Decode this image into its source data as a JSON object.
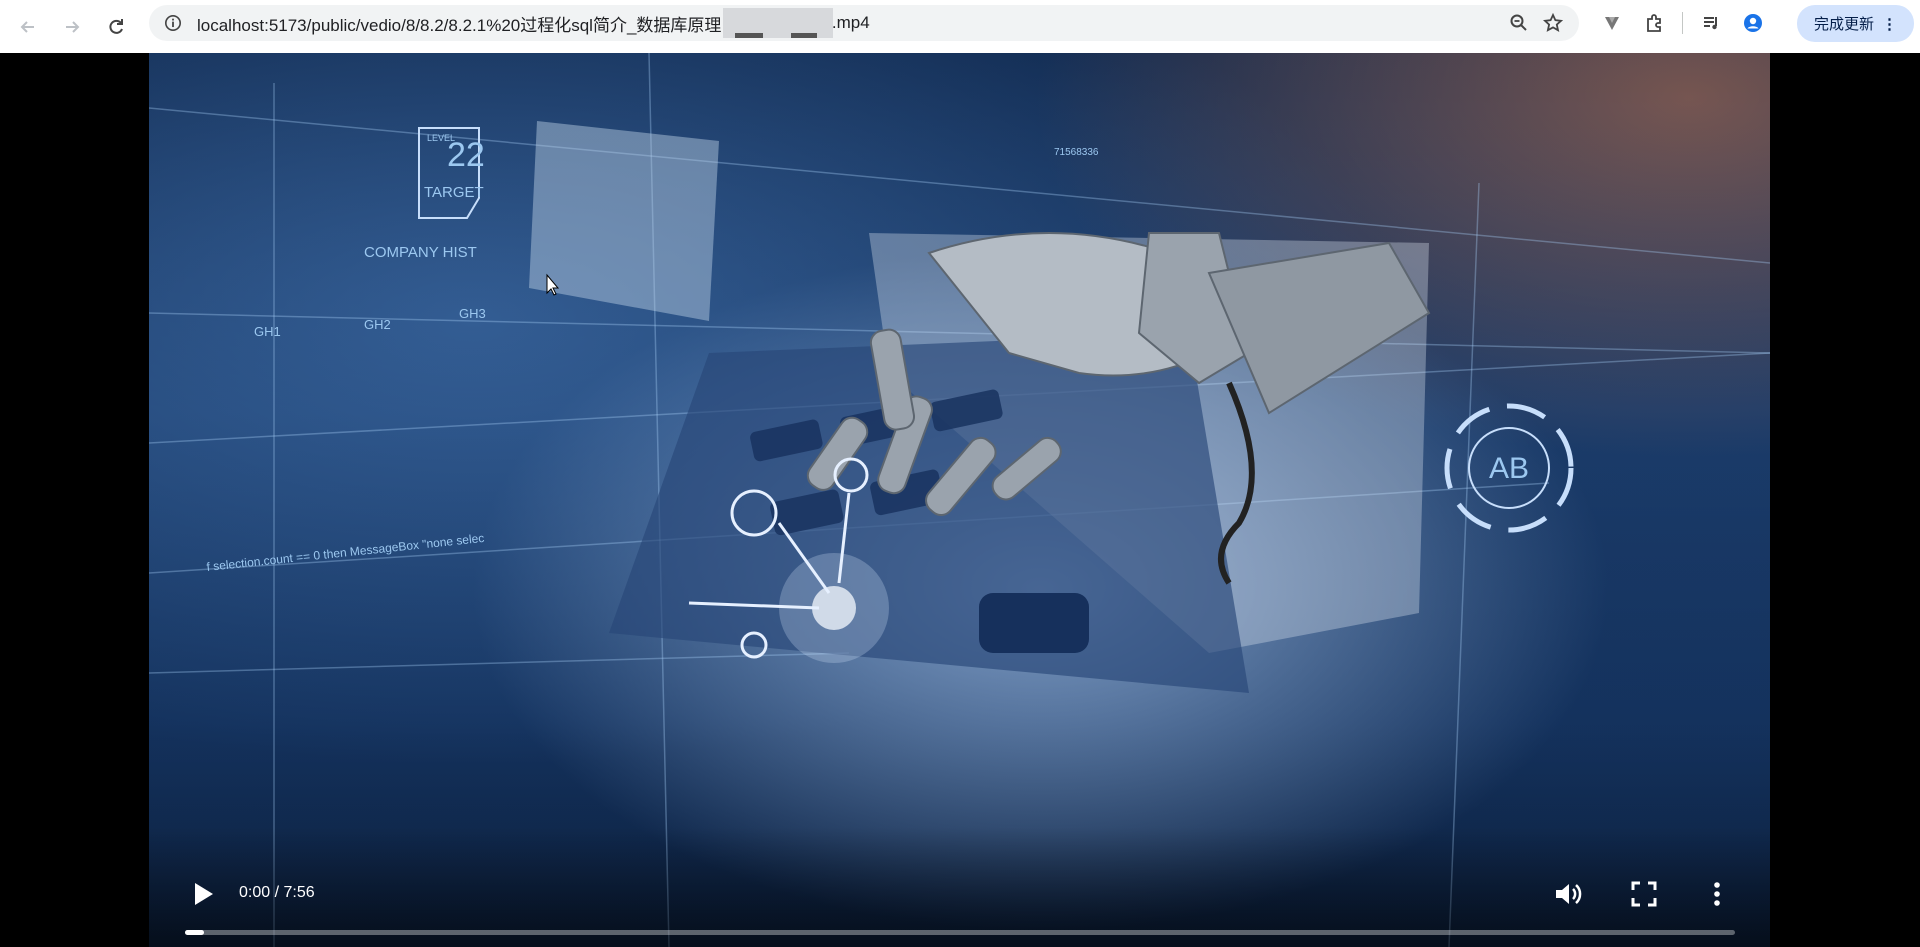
{
  "browser": {
    "url_prefix": "localhost:5173/public/vedio/8/8.2/8.2.1%20过程化sql简介_数据库原理",
    "url_suffix": "k.mp4",
    "update_button_label": "完成更新"
  },
  "icons": {
    "back": "arrow-left-icon",
    "forward": "arrow-right-icon",
    "reload": "reload-icon",
    "info": "info-icon",
    "zoom": "zoom-icon",
    "bookmark": "star-icon",
    "extension_v": "v-extension-icon",
    "extensions": "puzzle-icon",
    "media": "media-control-icon",
    "profile": "profile-icon"
  },
  "video": {
    "time_display": "0:00 / 7:56",
    "progress_fraction": 0.012,
    "hud": {
      "level_label": "LEVEL",
      "level_number": "22",
      "target_label": "TARGET",
      "company_hist": "COMPANY HIST",
      "gh1": "GH1",
      "gh2": "GH2",
      "gh3": "GH3",
      "code_line": "f selection.count == 0 then MessageBox \"none selec",
      "ab": "AB",
      "num1": "71568336"
    }
  }
}
